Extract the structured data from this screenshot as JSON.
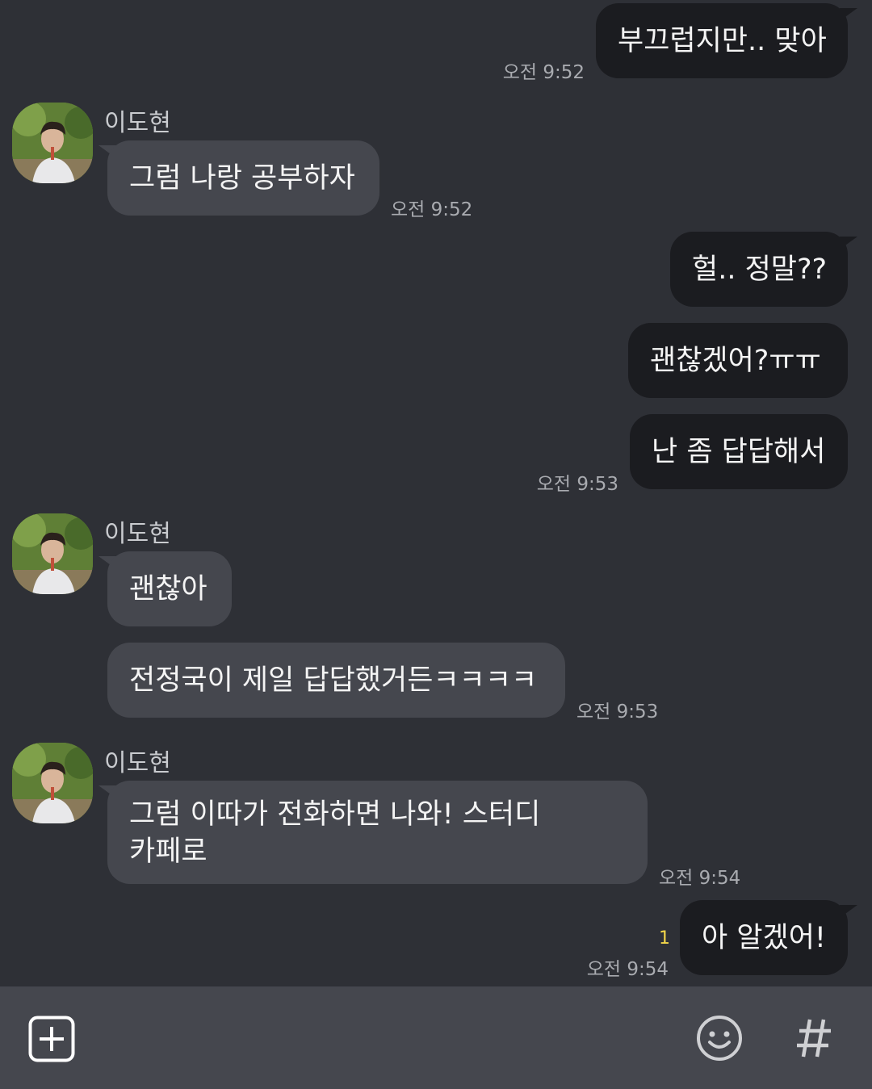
{
  "messages": [
    {
      "from": "me",
      "text": "부끄럽지만.. 맞아",
      "time": "오전 9:52"
    },
    {
      "from": "other",
      "name": "이도현",
      "text": "그럼 나랑 공부하자",
      "time": "오전 9:52"
    },
    {
      "from": "me",
      "text": "헐.. 정말??"
    },
    {
      "from": "me",
      "text": "괜찮겠어?ㅠㅠ"
    },
    {
      "from": "me",
      "text": "난 좀 답답해서",
      "time": "오전 9:53"
    },
    {
      "from": "other",
      "name": "이도현",
      "text": "괜찮아"
    },
    {
      "from": "other",
      "text": "전정국이 제일 답답했거든ㅋㅋㅋㅋ",
      "time": "오전 9:53"
    },
    {
      "from": "other",
      "name": "이도현",
      "text": "그럼 이따가 전화하면 나와! 스터디 카페로",
      "time": "오전 9:54"
    },
    {
      "from": "me",
      "text": "아 알겠어!",
      "time": "오전 9:54",
      "unread": "1"
    }
  ],
  "composer": {
    "attach_icon": "plus-square-icon",
    "emoji_icon": "smiley-icon",
    "hashtag_icon": "hashtag-icon"
  },
  "colors": {
    "background": "#2e3036",
    "my_bubble": "#1b1c20",
    "their_bubble": "#45474e",
    "unread": "#f5d84a"
  }
}
